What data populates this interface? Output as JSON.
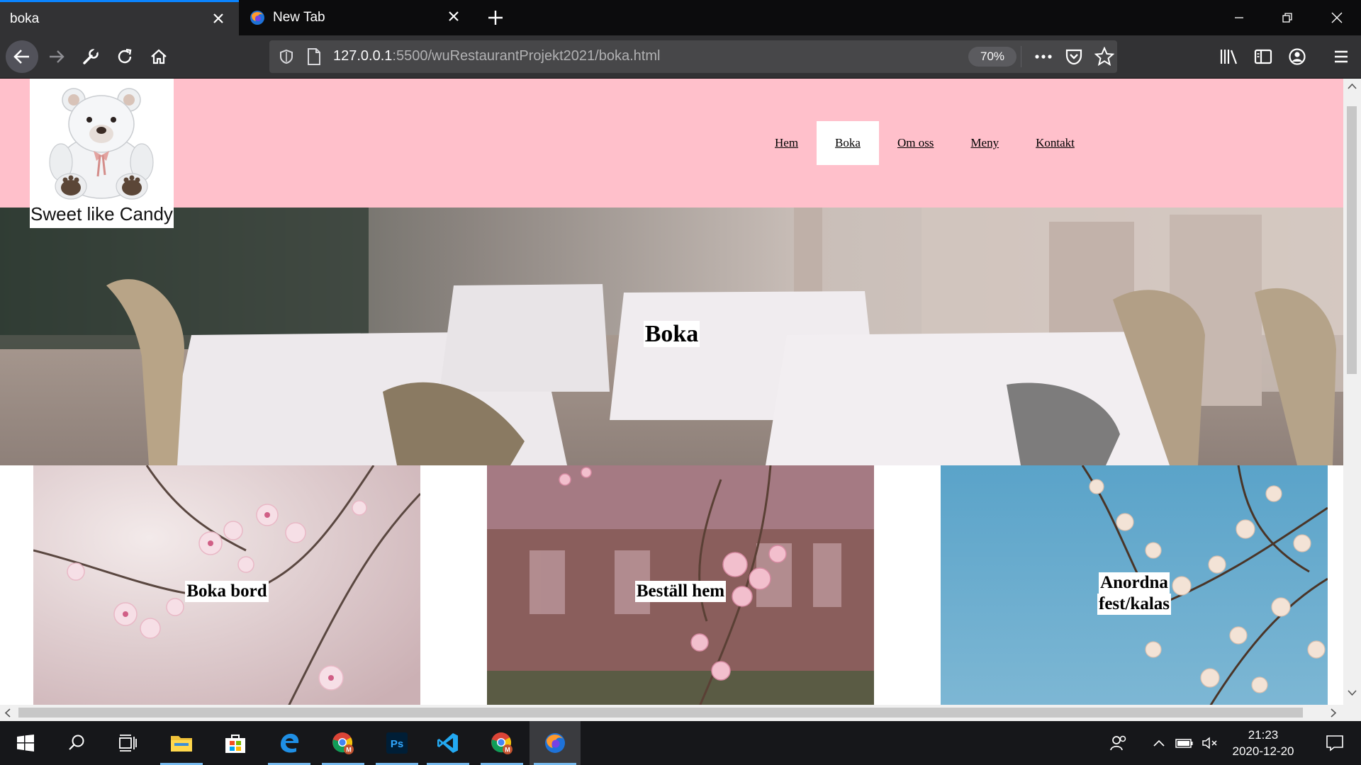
{
  "browser": {
    "tabs": [
      {
        "title": "boka",
        "active": true
      },
      {
        "title": "New Tab",
        "active": false
      }
    ],
    "url": {
      "host": "127.0.0.1",
      "rest": ":5500/wuRestaurantProjekt2021/boka.html"
    },
    "zoom": "70%"
  },
  "site": {
    "logo_text": "Sweet like Candy",
    "nav": [
      {
        "label": "Hem",
        "current": false
      },
      {
        "label": "Boka",
        "current": true
      },
      {
        "label": "Om oss",
        "current": false
      },
      {
        "label": "Meny",
        "current": false
      },
      {
        "label": "Kontakt",
        "current": false
      }
    ],
    "hero_title": "Boka",
    "cards": [
      {
        "line1": "Boka bord"
      },
      {
        "line1": "Beställ hem"
      },
      {
        "line1": "Anordna",
        "line2": "fest/kalas"
      }
    ],
    "colors": {
      "header_bg": "#ffc0cb",
      "nav_active_bg": "#ffffff"
    }
  },
  "taskbar": {
    "time": "21:23",
    "date": "2020-12-20"
  }
}
